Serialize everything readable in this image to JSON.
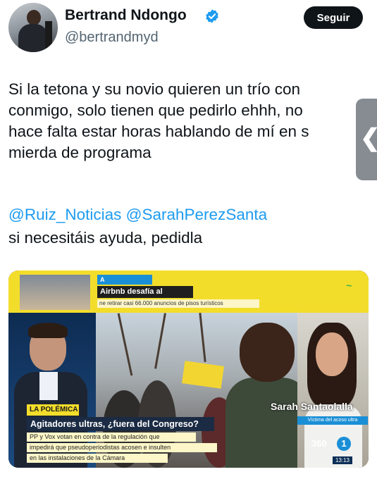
{
  "author": {
    "display_name": "Bertrand Ndongo",
    "handle": "@bertrandmyd",
    "verified_icon": "verified-badge-icon"
  },
  "actions": {
    "follow_label": "Seguir"
  },
  "tweet": {
    "text": "Si la tetona y su novio quieren un trío con\nconmigo, solo tienen que pedirlo ehhh, no\nhace falta estar horas hablando de mí en s\nmierda de programa",
    "mention_1": "@Ruiz_Noticias",
    "mention_2": "@SarahPerezSanta",
    "line_after_mentions": "si necesitáis ayuda, pedidla"
  },
  "side_tab": {
    "icon": "chevron-left-icon",
    "glyph": "❮"
  },
  "media": {
    "a_continuacion": "A CONTINUACIÓN",
    "next_headline": "Airbnb desafía al Gobierno",
    "next_sub": "ne retirar casi 66.000 anuncios de pisos turísticos",
    "reporter_name": "Sarah Santaolalla",
    "reporter_caption": "Víctima del acoso ultra",
    "section_label": "LA POLÉMICA",
    "headline": "Agitadores ultras, ¿fuera del Congreso?",
    "sub_1": "PP y Vox votan en contra de la regulación que",
    "sub_2": "impedirá que pseudoperiodistas acosen e insulten",
    "sub_3": "en las instalaciones de la Cámara",
    "channel_mark": "360",
    "channel_number": "1",
    "clock": "13:13"
  },
  "colors": {
    "follow_bg": "#0f1419",
    "mention": "#1d9bf0",
    "banner_yellow": "#f3dd2b",
    "banner_blue": "#1b8fd6"
  }
}
